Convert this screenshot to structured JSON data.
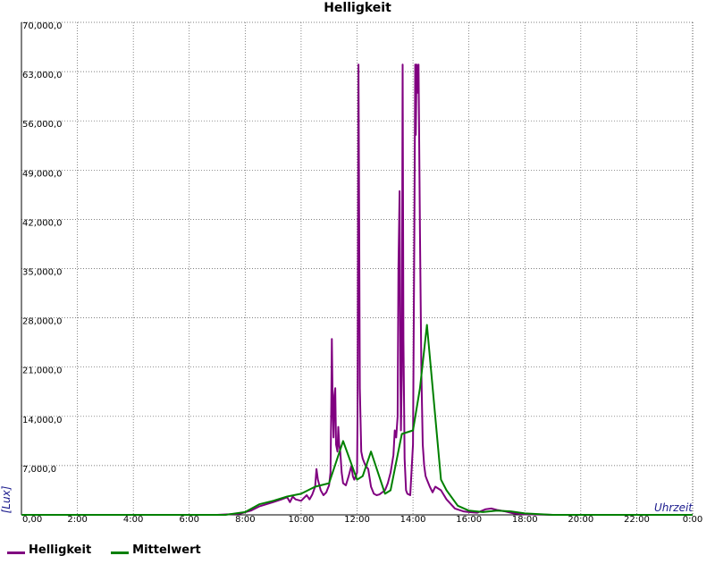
{
  "chart_data": {
    "type": "line",
    "title": "Helligkeit",
    "xlabel": "Uhrzeit",
    "ylabel": "[Lux]",
    "x_unit": "hours",
    "xlim": [
      0,
      24
    ],
    "ylim": [
      0,
      70000
    ],
    "x_ticks": [
      "0,00",
      "2:00",
      "4:00",
      "6:00",
      "8:00",
      "10:00",
      "12:00",
      "14:00",
      "16:00",
      "18:00",
      "20:00",
      "22:00",
      "0:00"
    ],
    "y_ticks": [
      "",
      "7,000,0",
      "14,000,0",
      "21,000,0",
      "28,000,0",
      "35,000,0",
      "42,000,0",
      "49,000,0",
      "56,000,0",
      "63,000,0",
      "70,000,0"
    ],
    "grid": true,
    "legend_position": "bottom-left",
    "series": [
      {
        "name": "Helligkeit",
        "color": "#800080",
        "points": [
          [
            0,
            0
          ],
          [
            7,
            0
          ],
          [
            7.8,
            150
          ],
          [
            8.2,
            600
          ],
          [
            8.5,
            1200
          ],
          [
            9.0,
            1800
          ],
          [
            9.3,
            2200
          ],
          [
            9.5,
            2500
          ],
          [
            9.6,
            1800
          ],
          [
            9.7,
            2600
          ],
          [
            9.8,
            2200
          ],
          [
            10.0,
            2000
          ],
          [
            10.2,
            2800
          ],
          [
            10.3,
            2200
          ],
          [
            10.4,
            2900
          ],
          [
            10.5,
            4000
          ],
          [
            10.55,
            6500
          ],
          [
            10.6,
            5000
          ],
          [
            10.7,
            3500
          ],
          [
            10.8,
            2800
          ],
          [
            10.9,
            3200
          ],
          [
            11.0,
            4200
          ],
          [
            11.05,
            6000
          ],
          [
            11.08,
            16000
          ],
          [
            11.1,
            25000
          ],
          [
            11.13,
            15000
          ],
          [
            11.16,
            11000
          ],
          [
            11.19,
            17000
          ],
          [
            11.22,
            18000
          ],
          [
            11.25,
            10000
          ],
          [
            11.3,
            9000
          ],
          [
            11.33,
            12500
          ],
          [
            11.36,
            10000
          ],
          [
            11.4,
            9000
          ],
          [
            11.45,
            6000
          ],
          [
            11.5,
            4500
          ],
          [
            11.6,
            4200
          ],
          [
            11.7,
            5500
          ],
          [
            11.8,
            7000
          ],
          [
            11.85,
            5500
          ],
          [
            11.9,
            5000
          ],
          [
            12.0,
            6000
          ],
          [
            12.02,
            15000
          ],
          [
            12.05,
            64000
          ],
          [
            12.08,
            38000
          ],
          [
            12.1,
            18000
          ],
          [
            12.15,
            9000
          ],
          [
            12.2,
            8000
          ],
          [
            12.3,
            7000
          ],
          [
            12.4,
            6500
          ],
          [
            12.5,
            4000
          ],
          [
            12.6,
            3000
          ],
          [
            12.7,
            2800
          ],
          [
            12.8,
            2900
          ],
          [
            13.0,
            3500
          ],
          [
            13.1,
            4500
          ],
          [
            13.2,
            6000
          ],
          [
            13.3,
            8500
          ],
          [
            13.35,
            12000
          ],
          [
            13.4,
            11000
          ],
          [
            13.45,
            14000
          ],
          [
            13.48,
            35000
          ],
          [
            13.52,
            46000
          ],
          [
            13.55,
            20000
          ],
          [
            13.57,
            12000
          ],
          [
            13.6,
            20000
          ],
          [
            13.63,
            64000
          ],
          [
            13.66,
            25000
          ],
          [
            13.7,
            8000
          ],
          [
            13.75,
            3500
          ],
          [
            13.8,
            3000
          ],
          [
            13.9,
            2800
          ],
          [
            14.0,
            10000
          ],
          [
            14.05,
            40000
          ],
          [
            14.08,
            64000
          ],
          [
            14.1,
            54000
          ],
          [
            14.13,
            64000
          ],
          [
            14.16,
            60000
          ],
          [
            14.2,
            64000
          ],
          [
            14.25,
            40000
          ],
          [
            14.3,
            20000
          ],
          [
            14.35,
            10000
          ],
          [
            14.4,
            7000
          ],
          [
            14.45,
            5500
          ],
          [
            14.5,
            5000
          ],
          [
            14.6,
            4000
          ],
          [
            14.7,
            3200
          ],
          [
            14.8,
            4000
          ],
          [
            15.0,
            3500
          ],
          [
            15.2,
            2200
          ],
          [
            15.5,
            900
          ],
          [
            15.8,
            500
          ],
          [
            16.0,
            400
          ],
          [
            16.3,
            300
          ],
          [
            16.6,
            800
          ],
          [
            16.8,
            900
          ],
          [
            17.0,
            700
          ],
          [
            17.3,
            500
          ],
          [
            17.6,
            200
          ],
          [
            18.0,
            80
          ],
          [
            19,
            0
          ],
          [
            24,
            0
          ]
        ]
      },
      {
        "name": "Mittelwert",
        "color": "#008000",
        "points": [
          [
            0,
            0
          ],
          [
            7.3,
            0
          ],
          [
            8.0,
            400
          ],
          [
            8.5,
            1500
          ],
          [
            9.0,
            2000
          ],
          [
            9.5,
            2600
          ],
          [
            10.0,
            3000
          ],
          [
            10.5,
            4000
          ],
          [
            11.0,
            4500
          ],
          [
            11.5,
            10500
          ],
          [
            12.0,
            5000
          ],
          [
            12.2,
            5500
          ],
          [
            12.5,
            9000
          ],
          [
            13.0,
            3000
          ],
          [
            13.2,
            3500
          ],
          [
            13.6,
            11500
          ],
          [
            14.0,
            12000
          ],
          [
            14.25,
            18000
          ],
          [
            14.5,
            27000
          ],
          [
            15.0,
            5000
          ],
          [
            15.2,
            3500
          ],
          [
            15.6,
            1300
          ],
          [
            16.0,
            600
          ],
          [
            16.5,
            400
          ],
          [
            17.0,
            600
          ],
          [
            17.5,
            500
          ],
          [
            18.0,
            200
          ],
          [
            19.0,
            0
          ],
          [
            24,
            0
          ]
        ]
      }
    ]
  }
}
